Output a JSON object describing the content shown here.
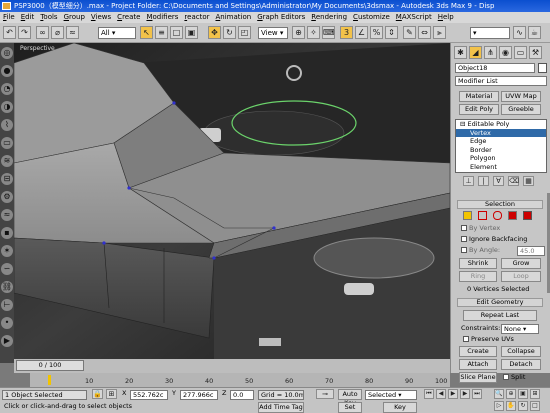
{
  "window": {
    "title": "PSP3000（模型细分）.max  - Project Folder: C:\\Documents and Settings\\Administrator\\My Documents\\3dsmax    - Autodesk 3ds Max 9    - Disp"
  },
  "menu": [
    "File",
    "Edit",
    "Tools",
    "Group",
    "Views",
    "Create",
    "Modifiers",
    "reactor",
    "Animation",
    "Graph Editors",
    "Rendering",
    "Customize",
    "MAXScript",
    "Help"
  ],
  "toolbar": {
    "selection_filter": "All",
    "ref_coord": "View",
    "named_selection": ""
  },
  "viewport": {
    "label": "Perspective"
  },
  "panel": {
    "object_name": "Object18",
    "modifier_list": "Modifier List",
    "buttons": [
      "Material",
      "UVW Map",
      "Edit Poly",
      "Greeble"
    ],
    "stack": [
      "Editable Poly",
      "Vertex",
      "Edge",
      "Border",
      "Polygon",
      "Element"
    ],
    "stack_selected": 1,
    "selection_title": "Selection",
    "by_vertex": "By Vertex",
    "ignore_backfacing": "Ignore Backfacing",
    "by_angle": "By Angle:",
    "angle_value": "45.0",
    "shrink": "Shrink",
    "grow": "Grow",
    "ring": "Ring",
    "loop": "Loop",
    "vertices_selected": "0 Vertices Selected",
    "edit_geometry_title": "Edit Geometry",
    "repeat_last": "Repeat Last",
    "constraints_label": "Constraints:",
    "constraints_value": "None",
    "preserve_uvs": "Preserve UVs",
    "create": "Create",
    "collapse": "Collapse",
    "attach": "Attach",
    "detach": "Detach",
    "slice_plane": "Slice Plane",
    "split": "Split"
  },
  "timeline": {
    "slider": "0 / 100",
    "ticks": [
      "10",
      "20",
      "30",
      "40",
      "50",
      "60",
      "70",
      "80",
      "90",
      "100"
    ]
  },
  "status": {
    "objects": "1 Object Selected",
    "prompt": "Click or click-and-drag to select objects",
    "x_label": "X",
    "x_value": "552.762c",
    "y_label": "Y",
    "y_value": "277.966c",
    "z_label": "Z",
    "z_value": "0.0",
    "grid": "Grid = 10.0mm",
    "add_time_tag": "Add Time Tag",
    "auto_key": "Auto Key",
    "auto_key_value": "Selected",
    "set_key": "Set Key",
    "key_filters": "Key Filters..."
  },
  "colors": {
    "title": "#0b4fcf",
    "selected_stack": "#2f6aa8",
    "subobj_active": "#f2c400",
    "spline": "#6bd36b",
    "edge_vertex": "#3030d0"
  }
}
